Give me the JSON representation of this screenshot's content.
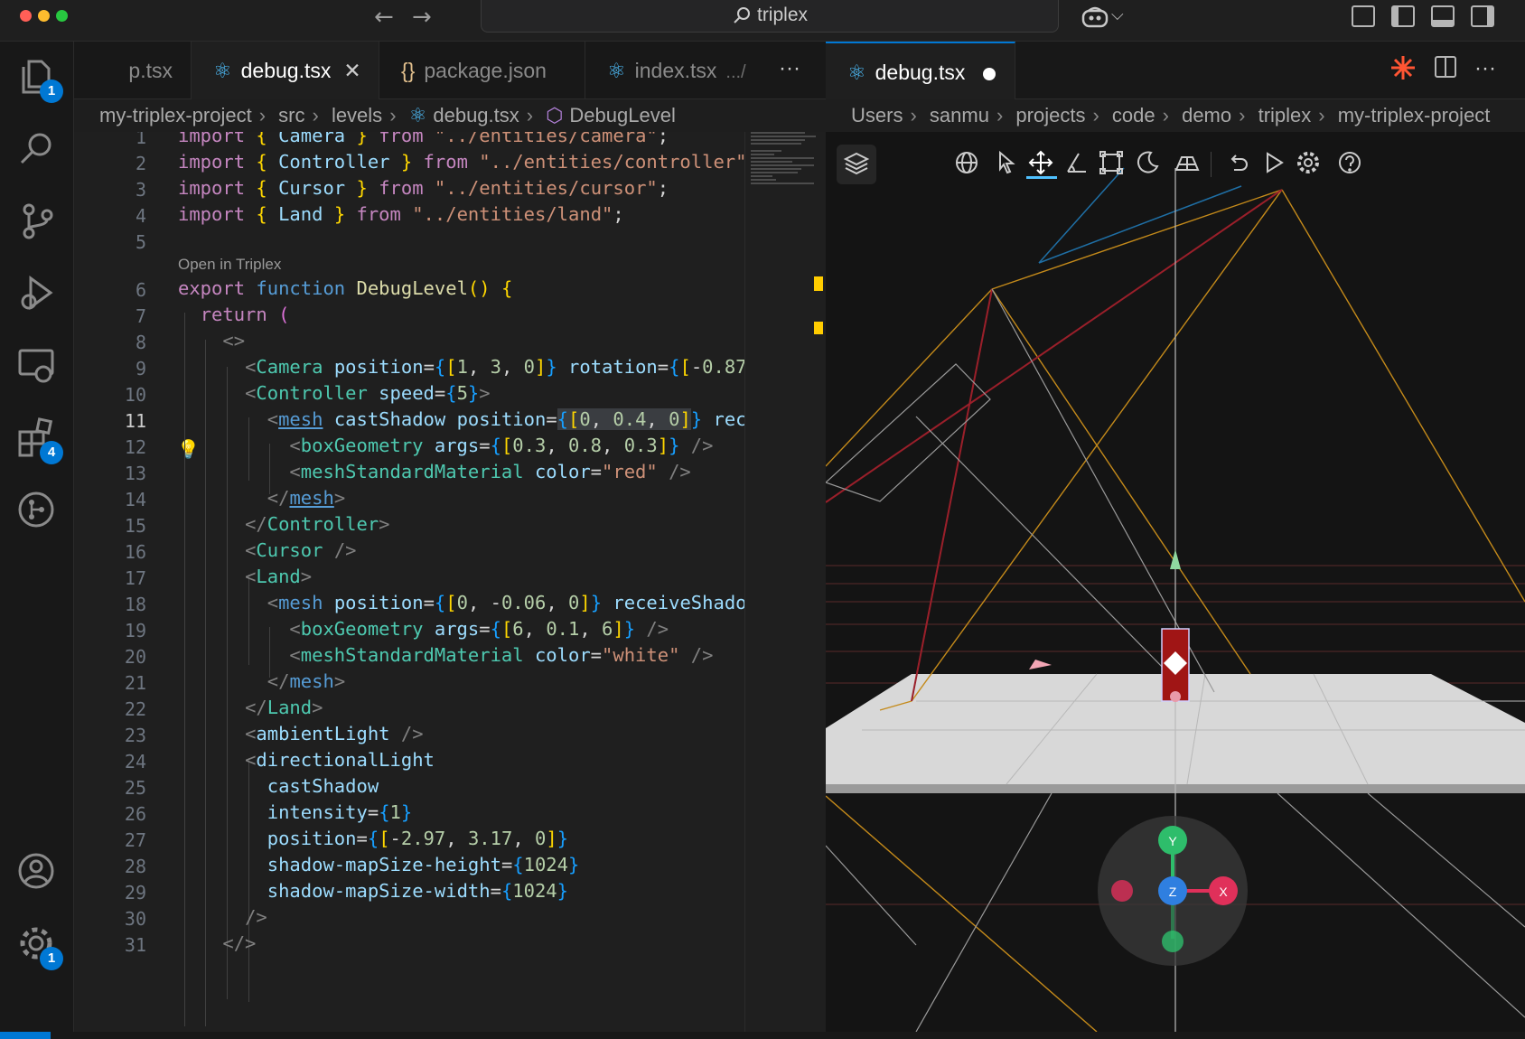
{
  "window": {
    "title": "triplex",
    "nav_back": "←",
    "nav_forward": "→",
    "copilot_caret": "⌵"
  },
  "activity_bar": {
    "explorer_badge": "1",
    "extensions_badge": "4",
    "settings_badge": "1"
  },
  "left_tabs": [
    {
      "label": "p.tsx"
    },
    {
      "label": "debug.tsx",
      "active": true
    },
    {
      "label": "package.json"
    },
    {
      "label": "index.tsx",
      "path_hint": ".../"
    }
  ],
  "left_tabs_more": "···",
  "right_tab": {
    "label": "debug.tsx",
    "modified": true
  },
  "right_tabs_more": "···",
  "left_breadcrumb": [
    "my-triplex-project",
    "src",
    "levels",
    "debug.tsx",
    "DebugLevel"
  ],
  "right_breadcrumb": [
    "Users",
    "sanmu",
    "projects",
    "code",
    "demo",
    "triplex",
    "my-triplex-project"
  ],
  "editor": {
    "current_line": 11,
    "codelens": "Open in Triplex",
    "line_numbers": [
      "1",
      "2",
      "3",
      "4",
      "5",
      "6",
      "7",
      "8",
      "9",
      "10",
      "11",
      "12",
      "13",
      "14",
      "15",
      "16",
      "17",
      "18",
      "19",
      "20",
      "21",
      "22",
      "23",
      "24",
      "25",
      "26",
      "27",
      "28",
      "29",
      "30",
      "31"
    ]
  },
  "gizmo": {
    "y": "Y",
    "x": "X",
    "z": "Z"
  },
  "accent_colors": {
    "accent": "#0078d4",
    "gizmo_x": "#e0305a",
    "gizmo_y": "#2ebd6b",
    "gizmo_z": "#2f7fe0"
  }
}
